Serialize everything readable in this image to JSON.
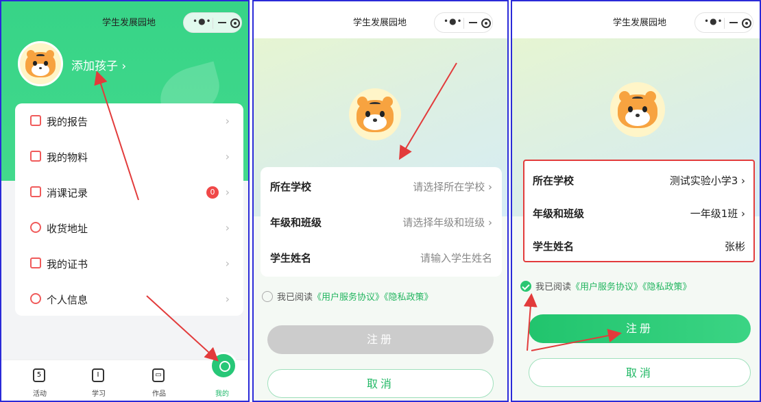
{
  "app_title": "学生发展园地",
  "panel1": {
    "add_child": "添加孩子 ›",
    "menu": [
      {
        "label": "我的报告",
        "icon": "report-icon"
      },
      {
        "label": "我的物料",
        "icon": "materials-icon"
      },
      {
        "label": "消课记录",
        "icon": "calendar-icon",
        "badge": "0"
      },
      {
        "label": "收货地址",
        "icon": "location-icon"
      },
      {
        "label": "我的证书",
        "icon": "certificate-icon"
      },
      {
        "label": "个人信息",
        "icon": "person-icon"
      }
    ],
    "chevron": "›",
    "tabs": [
      {
        "label": "活动",
        "icon_text": "5"
      },
      {
        "label": "学习",
        "icon_text": "I"
      },
      {
        "label": "作品",
        "icon_text": "▭"
      },
      {
        "label": "我的",
        "icon_text": ""
      }
    ]
  },
  "panel2": {
    "fields": [
      {
        "label": "所在学校",
        "placeholder": "请选择所在学校 ›"
      },
      {
        "label": "年级和班级",
        "placeholder": "请选择年级和班级 ›"
      },
      {
        "label": "学生姓名",
        "placeholder": "请输入学生姓名"
      }
    ],
    "agree_prefix": "我已阅读",
    "agree_link1": "《用户服务协议》",
    "agree_link2": "《隐私政策》",
    "register": "注册",
    "cancel": "取消"
  },
  "panel3": {
    "fields": [
      {
        "label": "所在学校",
        "value": "测试实验小学3 ›"
      },
      {
        "label": "年级和班级",
        "value": "一年级1班 ›"
      },
      {
        "label": "学生姓名",
        "value": "张彬"
      }
    ],
    "agree_prefix": "我已阅读",
    "agree_link1": "《用户服务协议》",
    "agree_link2": "《隐私政策》",
    "register": "注册",
    "cancel": "取消"
  },
  "colors": {
    "brand_green": "#27c777",
    "arrow_red": "#e23b3b",
    "frame_blue": "#2a2ad8"
  }
}
